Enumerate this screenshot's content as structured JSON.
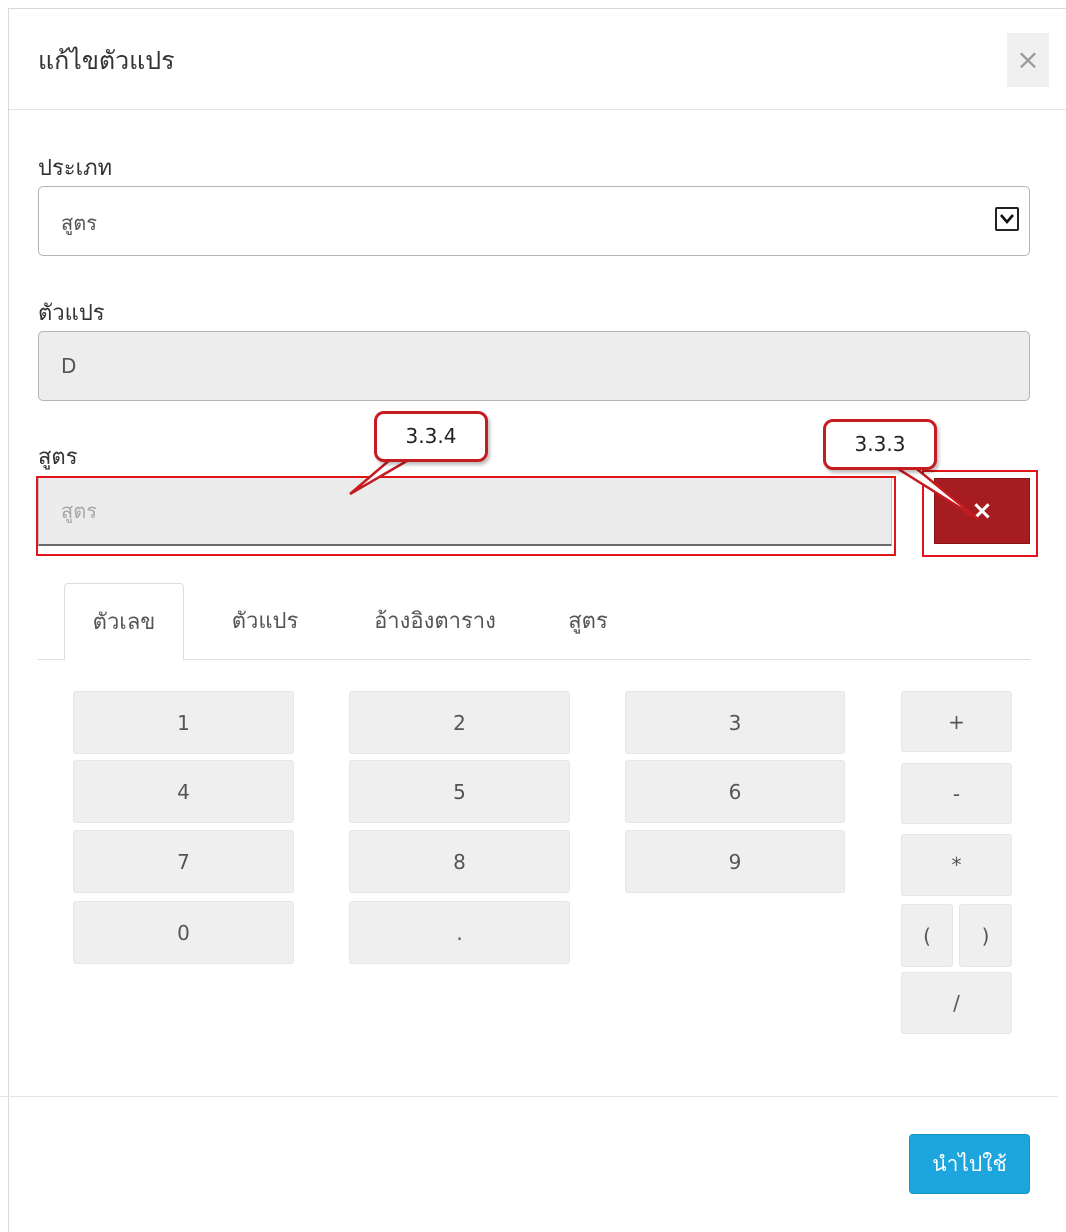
{
  "dialog": {
    "title": "แก้ไขตัวแปร",
    "close_symbol": "×"
  },
  "type_field": {
    "label": "ประเภท",
    "selected": "สูตร"
  },
  "variable_field": {
    "label": "ตัวแปร",
    "value": "D"
  },
  "formula_field": {
    "label": "สูตร",
    "placeholder": "สูตร",
    "clear_symbol": "×"
  },
  "annotations": {
    "formula_callout": "3.3.4",
    "clear_callout": "3.3.3",
    "highlight_color": "#e2141b"
  },
  "tabs": [
    {
      "label": "ตัวเลข",
      "active": true
    },
    {
      "label": "ตัวแปร",
      "active": false
    },
    {
      "label": "อ้างอิงตาราง",
      "active": false
    },
    {
      "label": "สูตร",
      "active": false
    }
  ],
  "keypad": {
    "digits": [
      "1",
      "2",
      "3",
      "4",
      "5",
      "6",
      "7",
      "8",
      "9",
      "0",
      "."
    ],
    "operators": [
      "+",
      "-",
      "*",
      "(",
      ")",
      "/"
    ]
  },
  "footer": {
    "apply_label": "นำไปใช้"
  },
  "colors": {
    "clear_button": "#a71c20",
    "apply_button": "#1da6dd",
    "key_background": "#efefef"
  }
}
